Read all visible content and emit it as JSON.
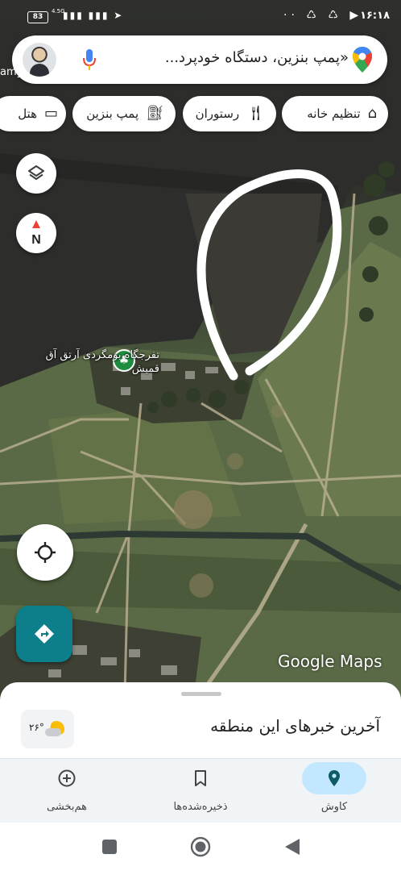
{
  "status_bar": {
    "time": "۱۶:۱۸",
    "battery": "83",
    "network": "4.5G",
    "left_icons": "▮▮▮ ▮▮▮ ➤",
    "right_icons": "·· ♺ ♺ ▶"
  },
  "search": {
    "placeholder": "«پمپ بنزین، دستگاه خودپرد..."
  },
  "map_edge_label": "amy",
  "chips": {
    "home": "تنظیم خانه",
    "restaurant": "رستوران",
    "gas": "پمپ بنزین",
    "hotel": "هتل"
  },
  "map": {
    "compass_letter": "N",
    "poi_label": "تفرجگاه بومگردی آرتق آق قمیش",
    "watermark": "Google Maps"
  },
  "sheet": {
    "title": "آخرین خبرهای این منطقه",
    "weather_temp": "۲۶°"
  },
  "nav": {
    "explore": "کاوش",
    "saved": "ذخیره‌شده‌ها",
    "contribute": "هم‌بخشی"
  },
  "colors": {
    "accent": "#0d7f8a",
    "active_nav_pill": "#c2e7ff",
    "poi_green": "#1e8e3e"
  }
}
